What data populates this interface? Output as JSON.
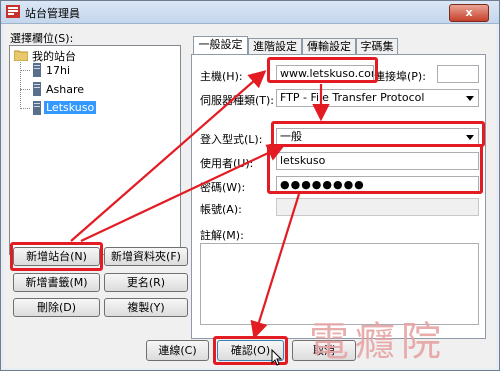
{
  "window": {
    "title": "站台管理員",
    "close": "x"
  },
  "left": {
    "select_label": "選擇欄位(S):",
    "tree_root": "我的站台",
    "sites": [
      "17hi",
      "Ashare",
      "Letskuso"
    ],
    "buttons": {
      "new_site": "新增站台(N)",
      "new_folder": "新增資料夾(F)",
      "new_bookmark": "新增書籤(M)",
      "rename": "更名(R)",
      "delete": "刪除(D)",
      "copy": "複製(Y)"
    }
  },
  "tabs": [
    "一般設定",
    "進階設定",
    "傳輸設定",
    "字碼集"
  ],
  "form": {
    "host_label": "主機(H):",
    "host_value": "www.letskuso.cor",
    "port_label": "連接埠(P):",
    "port_value": "",
    "server_type_label": "伺服器種類(T):",
    "server_type_value": "FTP - File Transfer Protocol",
    "logon_type_label": "登入型式(L):",
    "logon_type_value": "一般",
    "user_label": "使用者(U):",
    "user_value": "letskuso",
    "password_label": "密碼(W):",
    "password_value": "●●●●●●●●",
    "account_label": "帳號(A):",
    "account_value": "",
    "comment_label": "註解(M):"
  },
  "footer": {
    "connect": "連線(C)",
    "ok": "確認(O)",
    "cancel": "取消"
  },
  "watermark": "電癮院",
  "colors": {
    "highlight": "#e31b23",
    "selection": "#3399ff"
  }
}
